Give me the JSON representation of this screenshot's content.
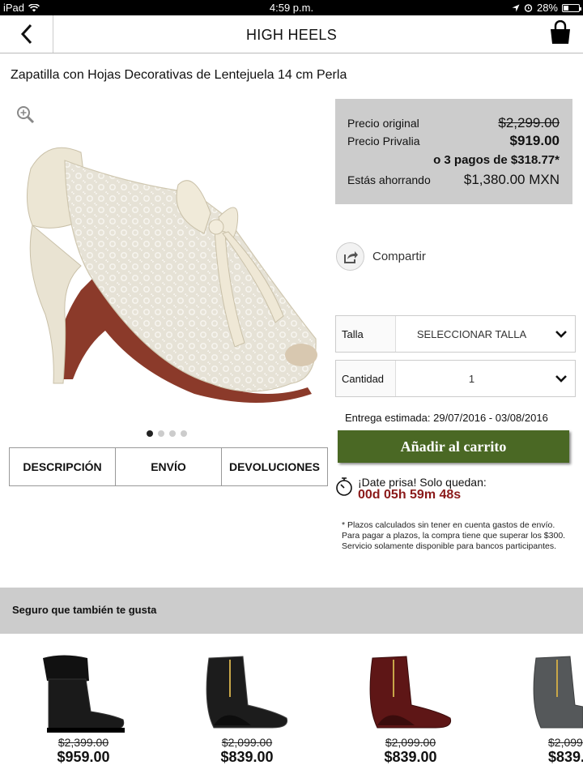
{
  "status_bar": {
    "device": "iPad",
    "time": "4:59 p.m.",
    "battery": "28%",
    "battery_level": 0.28
  },
  "nav": {
    "title": "HIGH HEELS"
  },
  "product": {
    "title": "Zapatilla con Hojas Decorativas de Lentejuela 14 cm Perla",
    "image_count": 4,
    "active_image": 1
  },
  "tabs": [
    "DESCRIPCIÓN",
    "ENVÍO",
    "DEVOLUCIONES"
  ],
  "prices": {
    "original_label": "Precio original",
    "original_value": "$2,299.00",
    "privalia_label": "Precio Privalia",
    "privalia_value": "$919.00",
    "installments": "o 3 pagos de $318.77*",
    "savings_label": "Estás ahorrando",
    "savings_value": "$1,380.00 MXN"
  },
  "share": {
    "label": "Compartir"
  },
  "size_select": {
    "label": "Talla",
    "value": "SELECCIONAR TALLA"
  },
  "qty_select": {
    "label": "Cantidad",
    "value": "1"
  },
  "delivery": "Entrega estimada: 29/07/2016 - 03/08/2016",
  "add_to_cart": "Añadir al carrito",
  "hurry": {
    "text": "¡Date prisa! Solo quedan:",
    "countdown": "00d 05h 59m 48s"
  },
  "footnote": "* Plazos calculados sin tener en cuenta gastos de envío. Para pagar a plazos, la compra tiene que superar los $300. Servicio solamente disponible para bancos participantes.",
  "recommendations": {
    "title": "Seguro que también te gusta",
    "items": [
      {
        "old_price": "$2,399.00",
        "price": "$959.00",
        "color": "#1a1a1a"
      },
      {
        "old_price": "$2,099.00",
        "price": "$839.00",
        "color": "#1c1c1c"
      },
      {
        "old_price": "$2,099.00",
        "price": "$839.00",
        "color": "#5e1616"
      },
      {
        "old_price": "$2,099",
        "price": "$839.",
        "color": "#55585a"
      }
    ]
  },
  "colors": {
    "cta_green": "#4a6824",
    "countdown_red": "#8b1a1a",
    "panel_gray": "#cccccc"
  }
}
